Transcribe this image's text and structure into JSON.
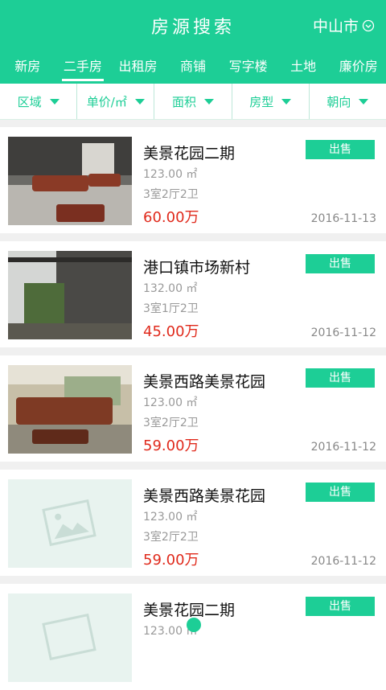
{
  "header": {
    "title": "房源搜索",
    "city": "中山市",
    "city_icon": "chevron-down-circle-icon"
  },
  "tabs": [
    "新房",
    "二手房",
    "出租房",
    "商铺",
    "写字楼",
    "土地",
    "廉价房"
  ],
  "active_tab": "二手房",
  "filters": [
    "区域",
    "单价/㎡",
    "面积",
    "房型",
    "朝向"
  ],
  "listings": [
    {
      "name": "美景花园二期",
      "area": "123.00 ㎡",
      "layout": "3室2厅2卫",
      "price": "60.00万",
      "badge": "出售",
      "date": "2016-11-13",
      "image": "living-room-photo"
    },
    {
      "name": "港口镇市场新村",
      "area": "132.00 ㎡",
      "layout": "3室1厅2卫",
      "price": "45.00万",
      "badge": "出售",
      "date": "2016-11-12",
      "image": "balcony-photo"
    },
    {
      "name": "美景西路美景花园",
      "area": "123.00 ㎡",
      "layout": "3室2厅2卫",
      "price": "59.00万",
      "badge": "出售",
      "date": "2016-11-12",
      "image": "living-room-photo"
    },
    {
      "name": "美景西路美景花园",
      "area": "123.00 ㎡",
      "layout": "3室2厅2卫",
      "price": "59.00万",
      "badge": "出售",
      "date": "2016-11-12",
      "image": "placeholder-image-icon"
    },
    {
      "name": "美景花园二期",
      "area": "123.00 ㎡",
      "layout": "",
      "price": "",
      "badge": "出售",
      "date": "",
      "image": "placeholder-image-icon"
    }
  ],
  "colors": {
    "accent": "#1dce96",
    "price": "#e02a1c"
  }
}
